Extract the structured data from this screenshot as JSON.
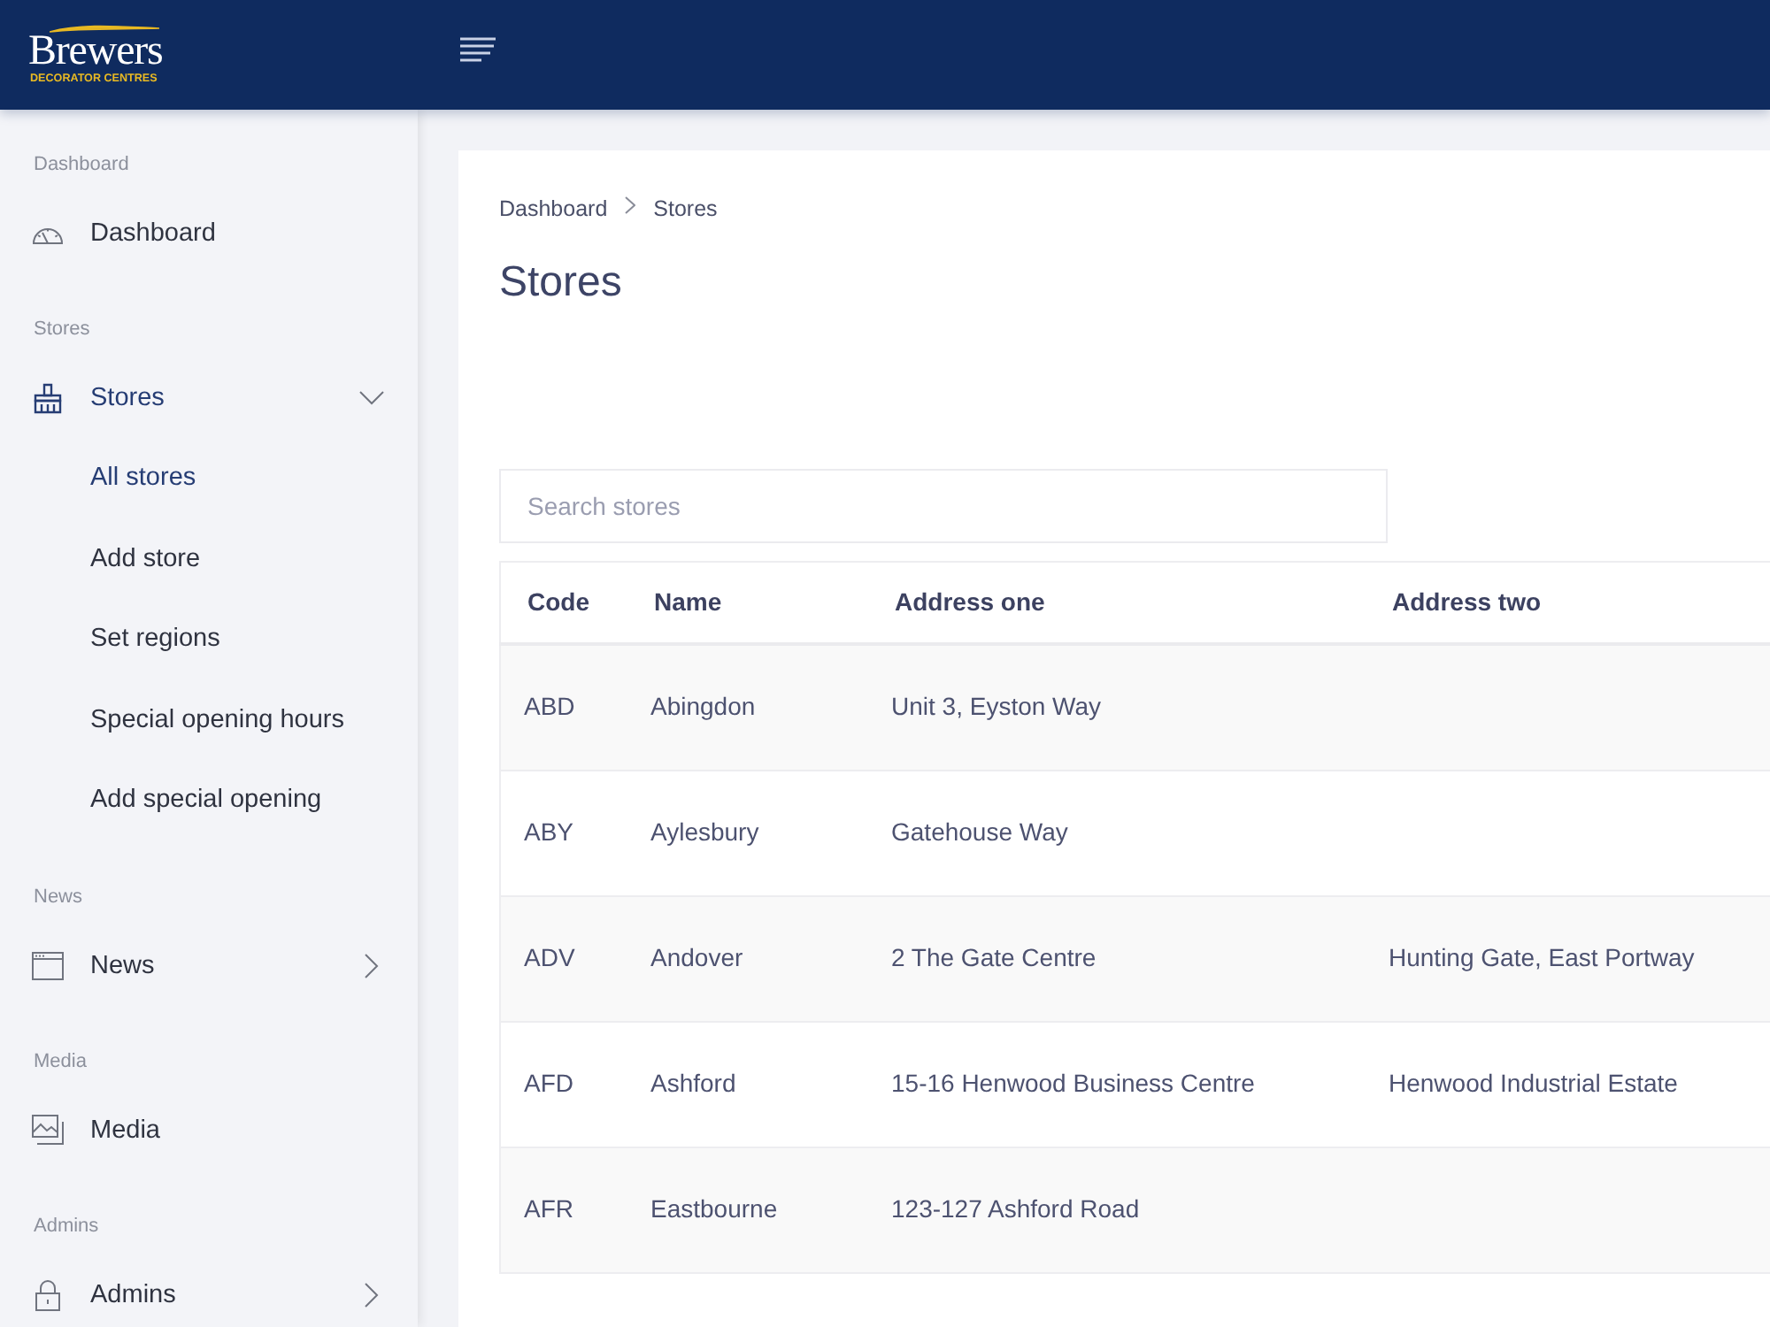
{
  "topbar": {
    "brand": {
      "name": "Brewers",
      "tagline": "DECORATOR CENTRES"
    }
  },
  "sidebar": {
    "sections": [
      {
        "heading": "Dashboard",
        "item": {
          "label": "Dashboard",
          "kind": "link",
          "selected": false
        }
      },
      {
        "heading": "Stores",
        "item": {
          "label": "Stores",
          "kind": "group",
          "selected": true,
          "expanded": true,
          "children": [
            {
              "label": "All stores",
              "selected": true
            },
            {
              "label": "Add store",
              "selected": false
            },
            {
              "label": "Set regions",
              "selected": false
            },
            {
              "label": "Special opening hours",
              "selected": false
            },
            {
              "label": "Add special opening",
              "selected": false
            }
          ]
        }
      },
      {
        "heading": "News",
        "item": {
          "label": "News",
          "kind": "group",
          "selected": false,
          "expanded": false
        }
      },
      {
        "heading": "Media",
        "item": {
          "label": "Media",
          "kind": "link",
          "selected": false
        }
      },
      {
        "heading": "Admins",
        "item": {
          "label": "Admins",
          "kind": "group",
          "selected": false,
          "expanded": false
        }
      }
    ]
  },
  "breadcrumb": [
    {
      "label": "Dashboard"
    },
    {
      "label": "Stores"
    }
  ],
  "page": {
    "title": "Stores"
  },
  "search": {
    "placeholder": "Search stores"
  },
  "table": {
    "columns": [
      "Code",
      "Name",
      "Address one",
      "Address two"
    ],
    "rows": [
      {
        "code": "ABD",
        "name": "Abingdon",
        "address_one": "Unit 3, Eyston Way"
      },
      {
        "code": "ABY",
        "name": "Aylesbury",
        "address_one": "Gatehouse Way"
      },
      {
        "code": "ADV",
        "name": "Andover",
        "address_one": "2 The Gate Centre",
        "address_two": "Hunting Gate, East Portway"
      },
      {
        "code": "AFD",
        "name": "Ashford",
        "address_one": "15-16 Henwood Business Centre",
        "address_two": "Henwood Industrial Estate"
      },
      {
        "code": "AFR",
        "name": "Eastbourne",
        "address_one": "123-127 Ashford Road"
      }
    ]
  }
}
